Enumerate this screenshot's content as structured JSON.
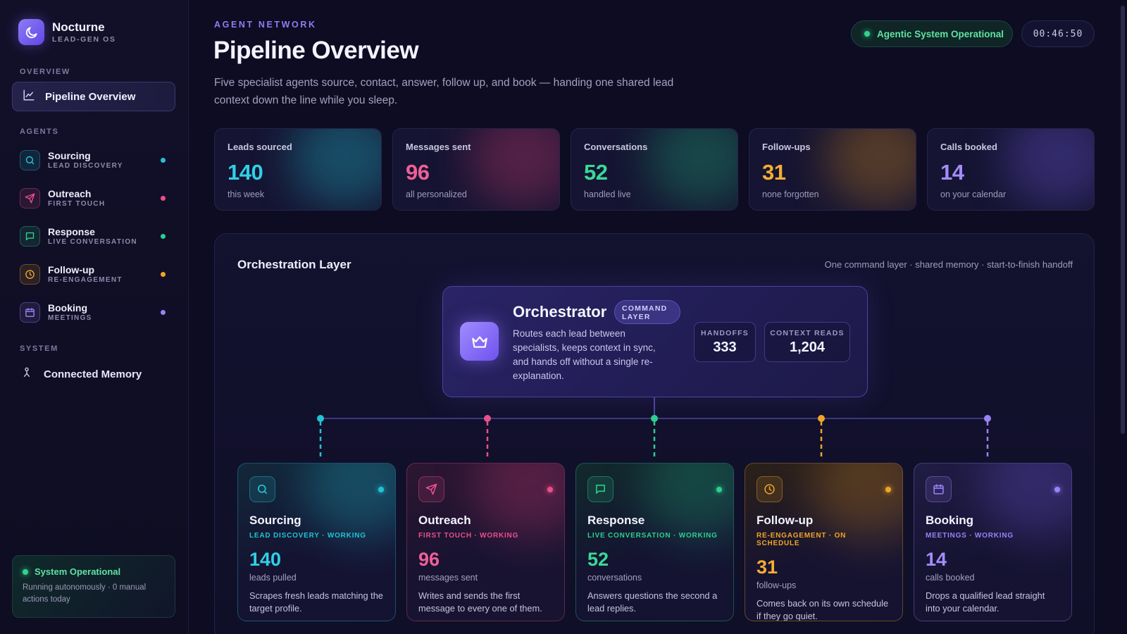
{
  "brand": {
    "name": "Nocturne",
    "sub": "LEAD-GEN OS",
    "color": "#7c63f6"
  },
  "sidebar": {
    "overview_label": "OVERVIEW",
    "nav_active": "Pipeline Overview",
    "agents_label": "AGENTS",
    "agents": [
      {
        "name": "Sourcing",
        "sub": "LEAD DISCOVERY",
        "color": "#22c3d6",
        "icon": "search-icon"
      },
      {
        "name": "Outreach",
        "sub": "FIRST TOUCH",
        "color": "#e8508a",
        "icon": "send-icon"
      },
      {
        "name": "Response",
        "sub": "LIVE CONVERSATION",
        "color": "#2ccf8f",
        "icon": "chat-icon"
      },
      {
        "name": "Follow-up",
        "sub": "RE-ENGAGEMENT",
        "color": "#f0a526",
        "icon": "clock-icon"
      },
      {
        "name": "Booking",
        "sub": "MEETINGS",
        "color": "#9a82f7",
        "icon": "calendar-icon"
      }
    ],
    "system_label": "SYSTEM",
    "memory_label": "Connected Memory",
    "status": {
      "title": "System Operational",
      "desc": "Running autonomously · 0 manual actions today"
    }
  },
  "header": {
    "eyebrow": "AGENT NETWORK",
    "title": "Pipeline Overview",
    "desc": "Five specialist agents source, contact, answer, follow up, and book — handing one shared lead context down the line while you sleep.",
    "status": "Agentic System Operational",
    "clock": "00:46:50"
  },
  "stats": [
    {
      "label": "Leads sourced",
      "value": "140",
      "sub": "this week",
      "color": "#2fd0e6"
    },
    {
      "label": "Messages sent",
      "value": "96",
      "sub": "all personalized",
      "color": "#ef5f97"
    },
    {
      "label": "Conversations",
      "value": "52",
      "sub": "handled live",
      "color": "#3ad898"
    },
    {
      "label": "Follow-ups",
      "value": "31",
      "sub": "none forgotten",
      "color": "#f4ad32"
    },
    {
      "label": "Calls booked",
      "value": "14",
      "sub": "on your calendar",
      "color": "#a48cfb"
    }
  ],
  "orchestration": {
    "title": "Orchestration Layer",
    "tagline": "One command layer · shared memory · start-to-finish handoff",
    "name": "Orchestrator",
    "badge_line1": "COMMAND",
    "badge_line2": "LAYER",
    "desc": "Routes each lead between specialists, keeps context in sync, and hands off without a single re-explanation.",
    "handoffs_label": "HANDOFFS",
    "handoffs_value": "333",
    "context_label": "CONTEXT READS",
    "context_value": "1,204"
  },
  "agent_cards": [
    {
      "name": "Sourcing",
      "status": "LEAD DISCOVERY · WORKING",
      "value": "140",
      "unit": "leads pulled",
      "desc": "Scrapes fresh leads matching the target profile.",
      "color": "#22c3d6",
      "icon": "search-icon"
    },
    {
      "name": "Outreach",
      "status": "FIRST TOUCH · WORKING",
      "value": "96",
      "unit": "messages sent",
      "desc": "Writes and sends the first message to every one of them.",
      "color": "#e8508a",
      "icon": "send-icon"
    },
    {
      "name": "Response",
      "status": "LIVE CONVERSATION · WORKING",
      "value": "52",
      "unit": "conversations",
      "desc": "Answers questions the second a lead replies.",
      "color": "#2ccf8f",
      "icon": "chat-icon"
    },
    {
      "name": "Follow-up",
      "status": "RE-ENGAGEMENT · ON SCHEDULE",
      "value": "31",
      "unit": "follow-ups",
      "desc": "Comes back on its own schedule if they go quiet.",
      "color": "#f0a526",
      "icon": "clock-icon"
    },
    {
      "name": "Booking",
      "status": "MEETINGS · WORKING",
      "value": "14",
      "unit": "calls booked",
      "desc": "Drops a qualified lead straight into your calendar.",
      "color": "#9a82f7",
      "icon": "calendar-icon"
    }
  ]
}
